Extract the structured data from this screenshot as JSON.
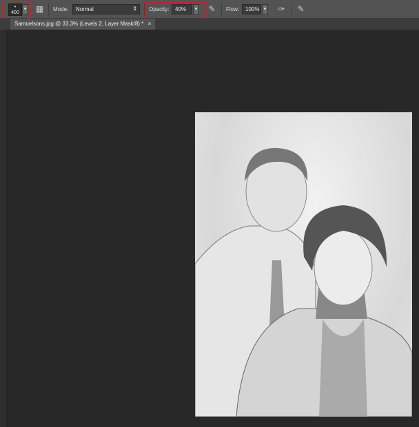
{
  "options_bar": {
    "brush_size": "400",
    "mode_label": "Mode:",
    "mode_value": "Normal",
    "opacity_label": "Opacity:",
    "opacity_value": "40%",
    "flow_label": "Flow:",
    "flow_value": "100%"
  },
  "document_tab": {
    "title": "Samuelsons.jpg @ 33.3% (Levels 2, Layer Mask/8) *",
    "close": "×"
  },
  "colors": {
    "annotation": "#c8202a"
  }
}
